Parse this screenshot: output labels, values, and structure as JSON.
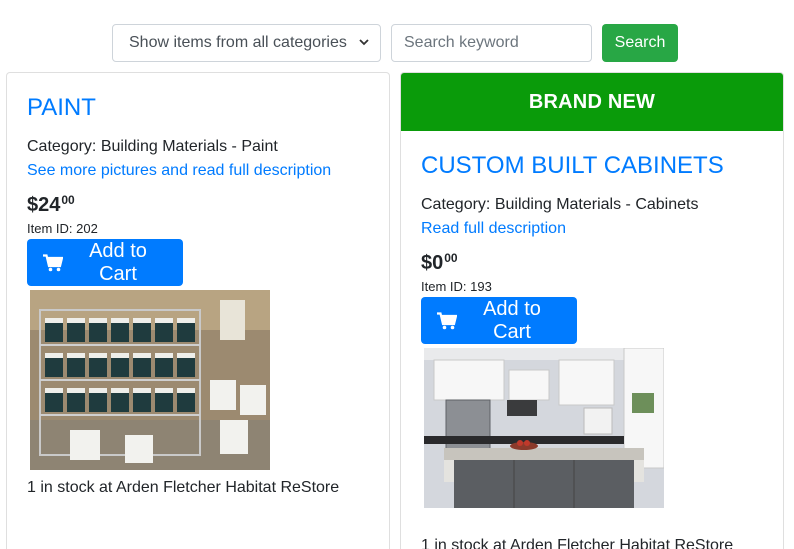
{
  "search": {
    "category_selected": "Show items from all categories",
    "keyword_placeholder": "Search keyword",
    "button_label": "Search"
  },
  "cards": [
    {
      "title": "PAINT",
      "category": "Category: Building Materials - Paint",
      "link": "See more pictures and read full description",
      "price_dollars": "$24",
      "price_cents": "00",
      "item_id": "Item ID: 202",
      "cart_label": "Add to Cart",
      "stock": "1 in stock at Arden Fletcher Habitat ReStore"
    },
    {
      "badge": "BRAND NEW",
      "title": "CUSTOM BUILT CABINETS",
      "category": "Category: Building Materials - Cabinets",
      "link": "Read full description",
      "price_dollars": "$0",
      "price_cents": "00",
      "item_id": "Item ID: 193",
      "cart_label": "Add to Cart",
      "stock": "1 in stock at Arden Fletcher Habitat ReStore"
    }
  ],
  "colors": {
    "link": "#007bff",
    "cart_button": "#007bff",
    "search_button": "#28a745",
    "badge": "#0a9b0a"
  },
  "icons": [
    "chevron-down-icon",
    "cart-icon"
  ]
}
